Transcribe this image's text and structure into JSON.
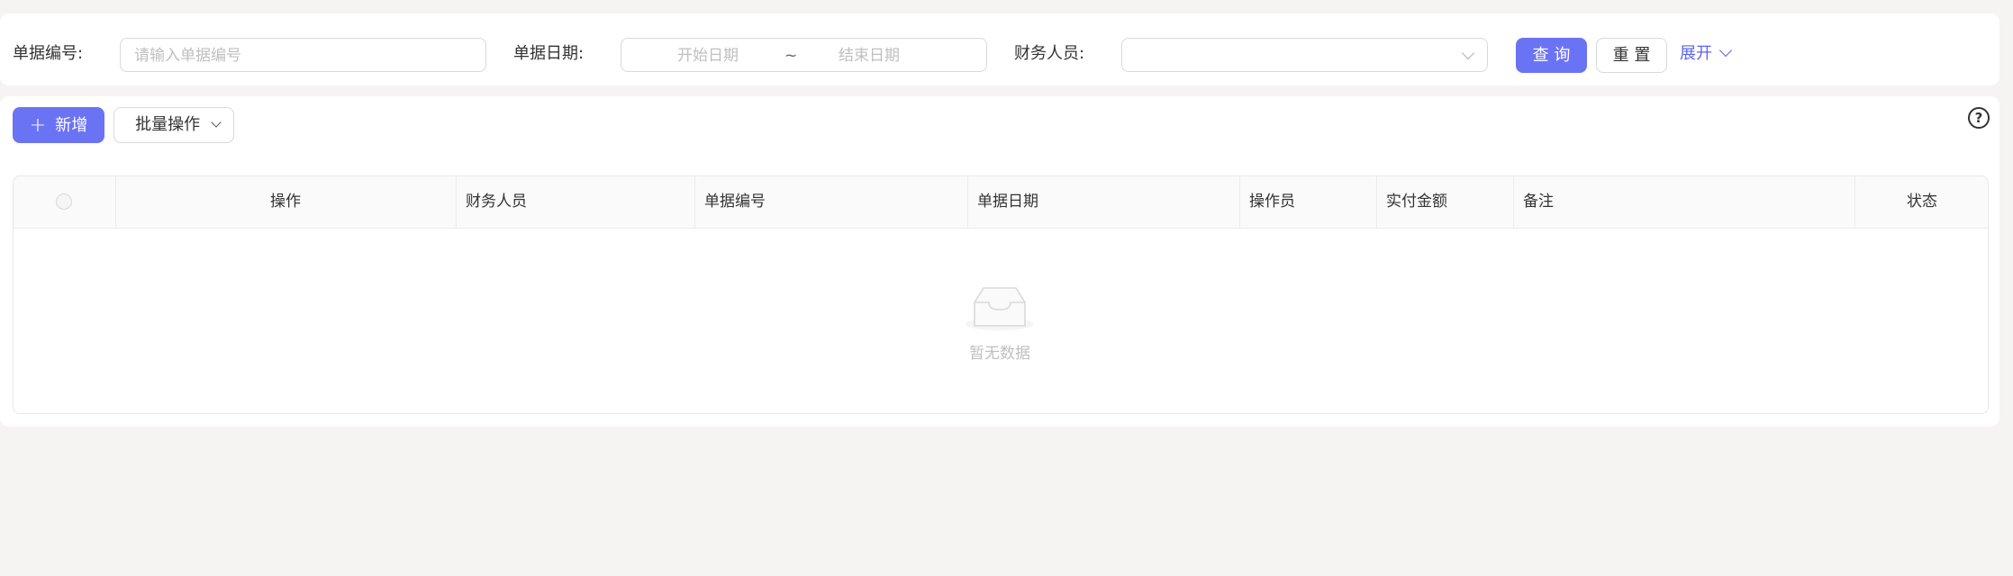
{
  "search": {
    "doc_no_label": "单据编号:",
    "doc_no_placeholder": "请输入单据编号",
    "doc_date_label": "单据日期:",
    "start_date_placeholder": "开始日期",
    "range_separator": "~",
    "end_date_placeholder": "结束日期",
    "finance_label": "财务人员:",
    "finance_value": "",
    "query_label": "查 询",
    "reset_label": "重 置",
    "expand_label": "展开"
  },
  "toolbar": {
    "add_label": "新增",
    "batch_label": "批量操作",
    "help_glyph": "?"
  },
  "table": {
    "columns": [
      "操作",
      "财务人员",
      "单据编号",
      "单据日期",
      "操作员",
      "实付金额",
      "备注",
      "状态"
    ],
    "empty_text": "暂无数据"
  },
  "colors": {
    "primary": "#6b73f5",
    "link": "#5b64f0",
    "background": "#f5f4f2"
  },
  "icons": {
    "finance_select": "chevron-down-icon",
    "expand": "chevron-down-icon",
    "add": "plus-icon",
    "batch": "chevron-down-icon",
    "help": "question-circle-icon",
    "empty": "empty-inbox-icon"
  }
}
